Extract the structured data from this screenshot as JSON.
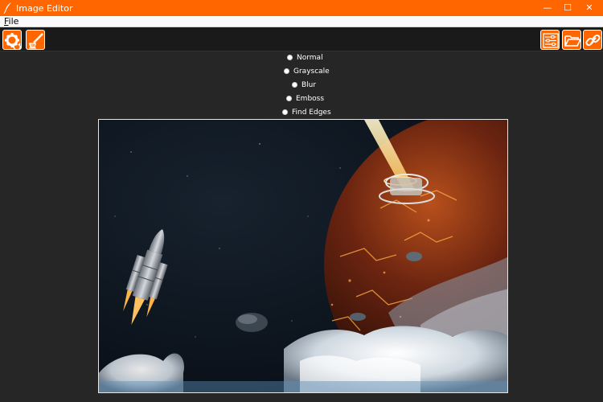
{
  "window": {
    "title": "Image Editor",
    "accent": "#ff6600",
    "controls": {
      "minimize": "—",
      "maximize": "☐",
      "close": "✕"
    }
  },
  "menubar": {
    "file": {
      "mnemonic": "F",
      "rest": "ile"
    }
  },
  "toolbar": {
    "left": [
      {
        "icon": "gear-refresh-icon"
      },
      {
        "icon": "brush-icon"
      }
    ],
    "right": [
      {
        "icon": "sliders-icon"
      },
      {
        "icon": "folder-open-icon"
      },
      {
        "icon": "link-icon"
      }
    ]
  },
  "filters": {
    "options": [
      "Normal",
      "Grayscale",
      "Blur",
      "Emboss",
      "Find Edges"
    ]
  },
  "image": {
    "subject": "space-scene"
  }
}
